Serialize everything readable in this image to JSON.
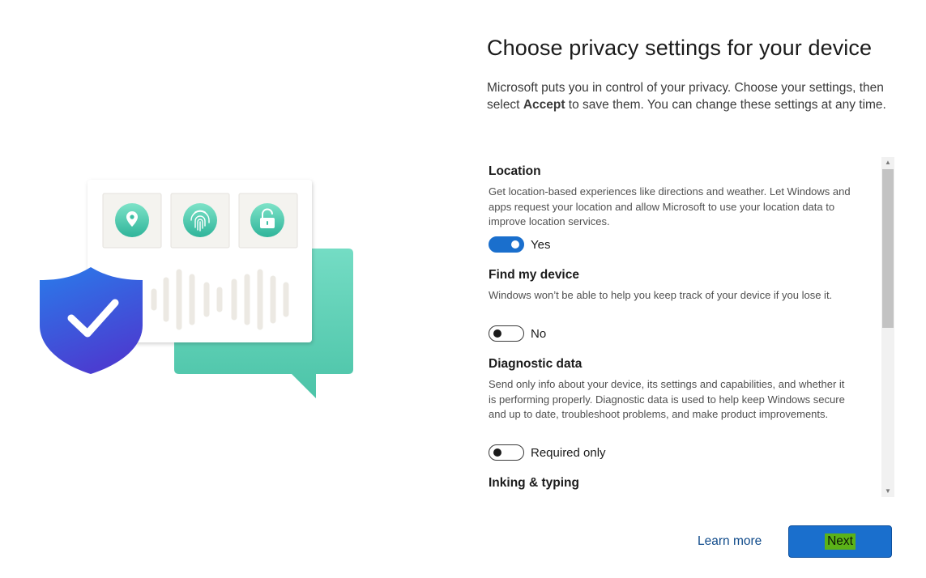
{
  "page": {
    "title": "Choose privacy settings for your device",
    "intro_before": "Microsoft puts you in control of your privacy. Choose your settings, then select ",
    "intro_bold": "Accept",
    "intro_after": " to save them. You can change these settings at any time."
  },
  "settings": [
    {
      "title": "Location",
      "description": "Get location-based experiences like directions and weather. Let Windows and apps request your location and allow Microsoft to use your location data to improve location services.",
      "toggle_on": true,
      "toggle_label": "Yes"
    },
    {
      "title": "Find my device",
      "description": "Windows won’t be able to help you keep track of your device if you lose it.",
      "toggle_on": false,
      "toggle_label": "No"
    },
    {
      "title": "Diagnostic data",
      "description": "Send only info about your device, its settings and capabilities, and whether it is performing properly. Diagnostic data is used to help keep Windows secure and up to date, troubleshoot problems, and make product improvements.",
      "toggle_on": false,
      "toggle_label": "Required only"
    },
    {
      "title": "Inking & typing"
    }
  ],
  "footer": {
    "learn_more": "Learn more",
    "next": "Next"
  },
  "colors": {
    "accent": "#1a6fcd",
    "link": "#0f4a8a",
    "next_highlight": "#5bb218"
  },
  "illustration": {
    "icons": [
      "location-pin-icon",
      "fingerprint-icon",
      "unlocked-padlock-icon",
      "shield-check-icon",
      "chat-bubble-icon",
      "audio-waveform-icon"
    ]
  }
}
